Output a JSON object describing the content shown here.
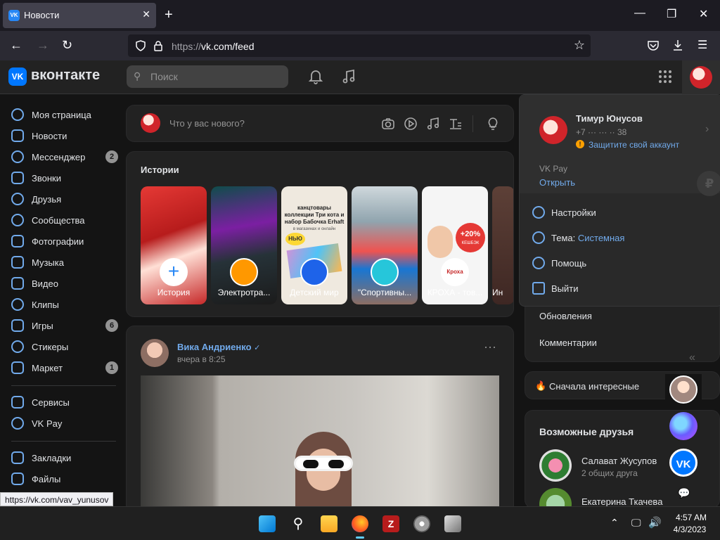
{
  "browser": {
    "tab_title": "Новости",
    "url_prefix": "https://",
    "url_main": "vk.com/feed",
    "status_url": "https://vk.com/vav_yunusov"
  },
  "header": {
    "brand": "вконтакте",
    "search_placeholder": "Поиск"
  },
  "sidebar": {
    "items": [
      {
        "label": "Моя страница",
        "badge": ""
      },
      {
        "label": "Новости",
        "badge": ""
      },
      {
        "label": "Мессенджер",
        "badge": "2"
      },
      {
        "label": "Звонки",
        "badge": ""
      },
      {
        "label": "Друзья",
        "badge": ""
      },
      {
        "label": "Сообщества",
        "badge": ""
      },
      {
        "label": "Фотографии",
        "badge": ""
      },
      {
        "label": "Музыка",
        "badge": ""
      },
      {
        "label": "Видео",
        "badge": ""
      },
      {
        "label": "Клипы",
        "badge": ""
      },
      {
        "label": "Игры",
        "badge": "6"
      },
      {
        "label": "Стикеры",
        "badge": ""
      },
      {
        "label": "Маркет",
        "badge": "1"
      }
    ],
    "items2": [
      {
        "label": "Сервисы"
      },
      {
        "label": "VK Pay"
      }
    ],
    "items3": [
      {
        "label": "Закладки"
      },
      {
        "label": "Файлы"
      }
    ]
  },
  "compose": {
    "placeholder": "Что у вас нового?"
  },
  "stories": {
    "title": "Истории",
    "items": [
      {
        "name": "История"
      },
      {
        "name": "Электротра..."
      },
      {
        "name": "Детский мир"
      },
      {
        "name": "\"Спортивны..."
      },
      {
        "name": "КРОХА - тов..."
      },
      {
        "name": "Ин"
      }
    ],
    "card3_text": "канцтовары коллекции Три кота и набор Бабочка Erhaft",
    "card3_sub": "в магазинах и онлайн",
    "card3_badge": "НЬЮ",
    "card5_badge": "+20%",
    "card5_sub": "КЕШБЭК",
    "card5_logo": "Кроха"
  },
  "post": {
    "author": "Вика Андриенко",
    "time": "вчера в 8:25"
  },
  "profile_menu": {
    "name": "Тимур Юнусов",
    "phone": "+7 ··· ··· ·· 38",
    "protect": "Защитите свой аккаунт",
    "vkpay_label": "VK Pay",
    "vkpay_action": "Открыть",
    "items": [
      {
        "label": "Настройки"
      },
      {
        "label": "Тема:",
        "value": "Системная"
      },
      {
        "label": "Помощь"
      },
      {
        "label": "Выйти"
      }
    ]
  },
  "right_panel": {
    "updates": "Обновления",
    "comments": "Комментарии",
    "sort": "Сначала интересные",
    "friends_title": "Возможные друзья",
    "friends": [
      {
        "name": "Салават Жусупов",
        "mutual": "2 общих друга"
      },
      {
        "name": "Екатерина Ткачева",
        "mutual": ""
      }
    ]
  },
  "taskbar": {
    "time": "4:57 AM",
    "date": "4/3/2023"
  },
  "colors": {
    "vk_blue": "#0077ff",
    "link": "#71aaeb",
    "bg": "#141414",
    "card": "#222222"
  }
}
